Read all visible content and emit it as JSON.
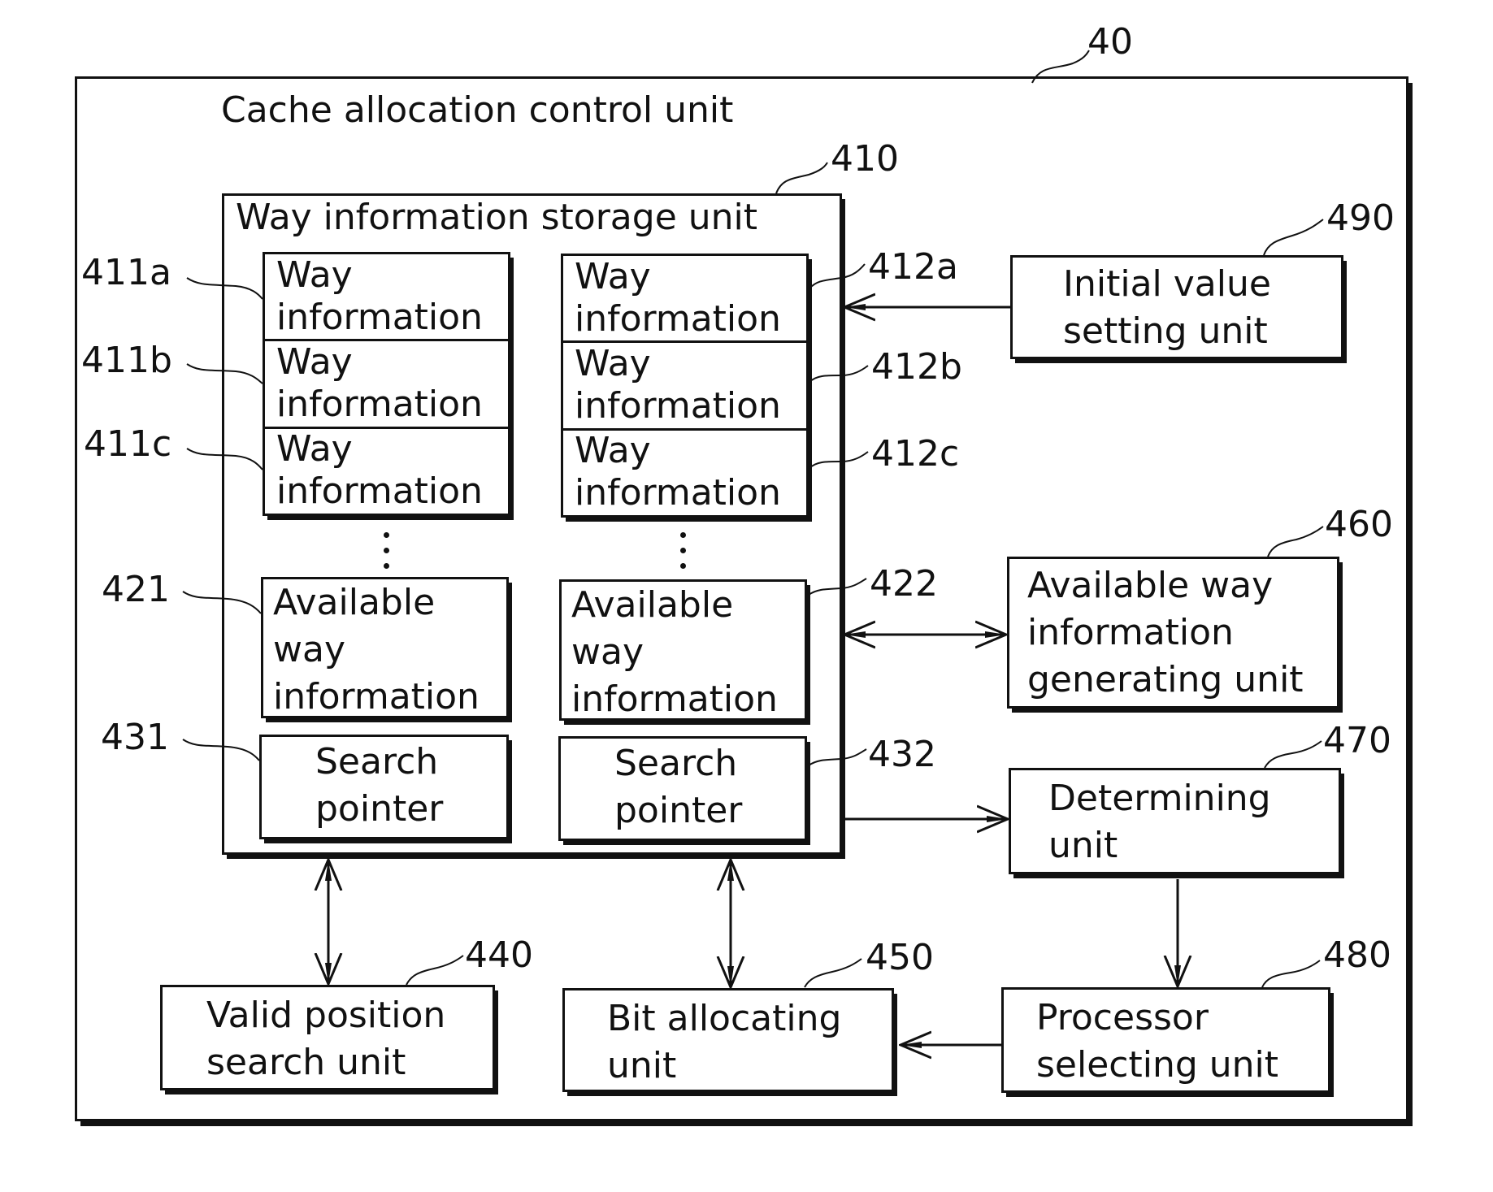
{
  "diagram": {
    "title": "Cache allocation control unit",
    "ref": "40",
    "storage_unit": {
      "title": "Way information storage unit",
      "ref": "410",
      "left_column": {
        "way_entries": [
          {
            "ref": "411a",
            "line1": "Way",
            "line2": "information"
          },
          {
            "ref": "411b",
            "line1": "Way",
            "line2": "information"
          },
          {
            "ref": "411c",
            "line1": "Way",
            "line2": "information"
          }
        ],
        "available": {
          "ref": "421",
          "line1": "Available",
          "line2": "way",
          "line3": "information"
        },
        "pointer": {
          "ref": "431",
          "line1": "Search",
          "line2": "pointer"
        }
      },
      "right_column": {
        "way_entries": [
          {
            "ref": "412a",
            "line1": "Way",
            "line2": "information"
          },
          {
            "ref": "412b",
            "line1": "Way",
            "line2": "information"
          },
          {
            "ref": "412c",
            "line1": "Way",
            "line2": "information"
          }
        ],
        "available": {
          "ref": "422",
          "line1": "Available",
          "line2": "way",
          "line3": "information"
        },
        "pointer": {
          "ref": "432",
          "line1": "Search",
          "line2": "pointer"
        }
      }
    },
    "units": {
      "initial_value": {
        "ref": "490",
        "line1": "Initial value",
        "line2": "setting unit"
      },
      "available_gen": {
        "ref": "460",
        "line1": "Available way",
        "line2": "information",
        "line3": "generating unit"
      },
      "determining": {
        "ref": "470",
        "line1": "Determining",
        "line2": "unit"
      },
      "processor_select": {
        "ref": "480",
        "line1": "Processor",
        "line2": "selecting unit"
      },
      "valid_search": {
        "ref": "440",
        "line1": "Valid position",
        "line2": "search unit"
      },
      "bit_alloc": {
        "ref": "450",
        "line1": "Bit allocating",
        "line2": "unit"
      }
    },
    "connections": [
      {
        "from": "490",
        "to": "410",
        "type": "one-way"
      },
      {
        "from": "410",
        "to": "460",
        "type": "two-way"
      },
      {
        "from": "410",
        "to": "470",
        "type": "one-way"
      },
      {
        "from": "470",
        "to": "480",
        "type": "one-way"
      },
      {
        "from": "480",
        "to": "450",
        "type": "one-way"
      },
      {
        "from": "410",
        "to": "440",
        "type": "two-way"
      },
      {
        "from": "410",
        "to": "450",
        "type": "two-way"
      }
    ]
  }
}
